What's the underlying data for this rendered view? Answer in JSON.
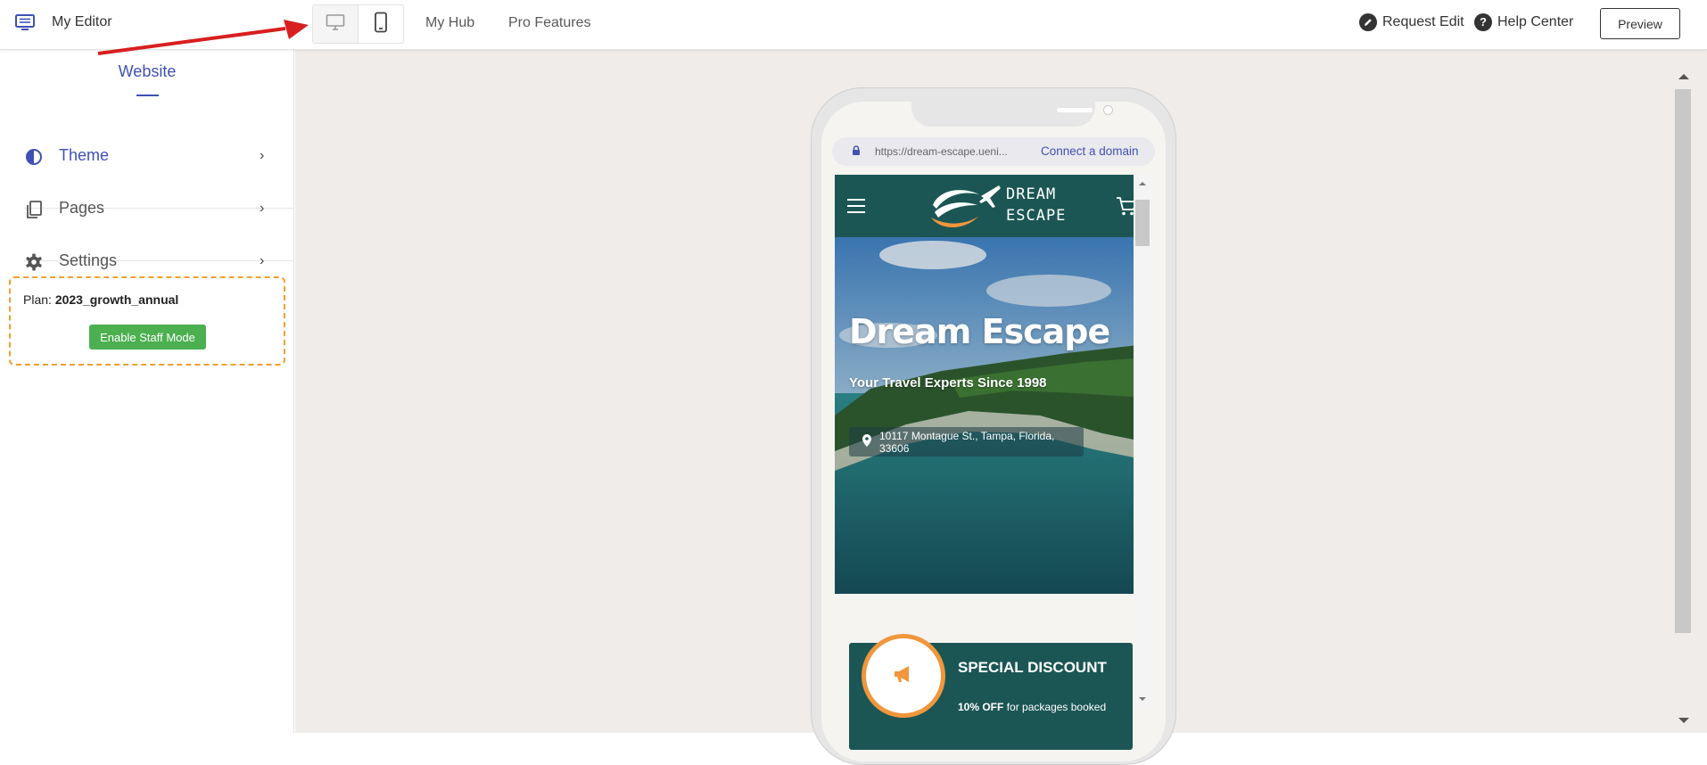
{
  "header": {
    "brand_name": "My Editor",
    "nav": {
      "my_hub": "My Hub",
      "pro_features": "Pro Features"
    },
    "request_edit": "Request Edit",
    "help_center": "Help Center",
    "preview": "Preview",
    "device_modes": [
      "desktop",
      "mobile"
    ],
    "selected_device": "mobile"
  },
  "sidebar": {
    "tab": "Website",
    "items": [
      {
        "label": "Theme",
        "icon": "theme-contrast-icon",
        "active": true
      },
      {
        "label": "Pages",
        "icon": "pages-icon",
        "active": false
      },
      {
        "label": "Settings",
        "icon": "gear-icon",
        "active": false
      }
    ],
    "plan": {
      "prefix": "Plan:",
      "value": "2023_growth_annual",
      "staff_button": "Enable Staff Mode"
    }
  },
  "preview": {
    "url": "https://dream-escape.ueni...",
    "connect_domain": "Connect a domain",
    "site": {
      "logo_line1": "DREAM",
      "logo_line2": "ESCAPE",
      "hero_title": "Dream Escape",
      "hero_subtitle": "Your Travel Experts Since 1998",
      "address": "10117 Montague St., Tampa, Florida, 33606",
      "discount_title": "SPECIAL DISCOUNT",
      "discount_bold": "10% OFF",
      "discount_text": "for packages booked"
    }
  },
  "colors": {
    "accent": "#3f51b5",
    "site_primary": "#1b5654",
    "site_orange": "#f0963c",
    "staff_button": "#4caf50",
    "plan_border": "#f0a030",
    "annotation_arrow": "#d81f1f",
    "canvas_bg": "#efece9"
  }
}
